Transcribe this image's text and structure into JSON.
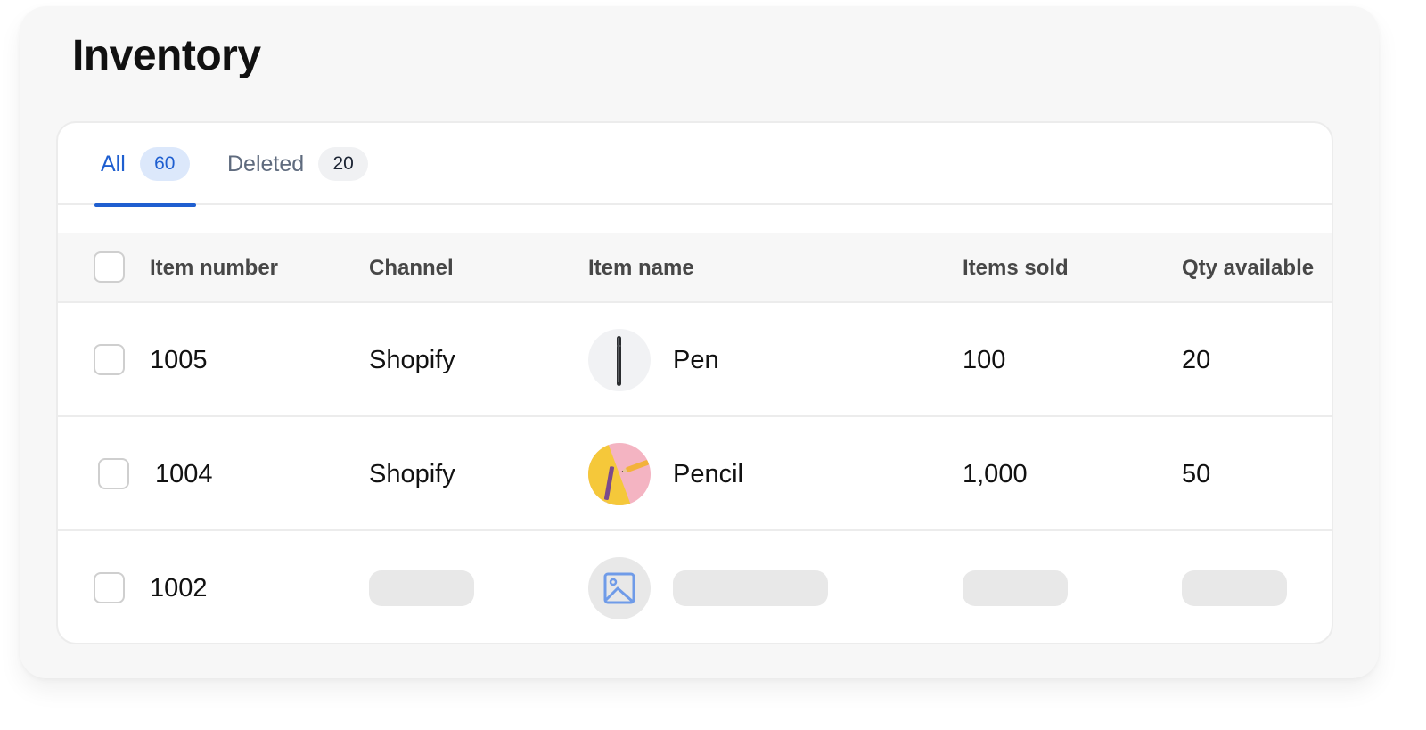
{
  "page": {
    "title": "Inventory"
  },
  "tabs": [
    {
      "label": "All",
      "count": "60",
      "active": true
    },
    {
      "label": "Deleted",
      "count": "20",
      "active": false
    }
  ],
  "table": {
    "columns": [
      "Item number",
      "Channel",
      "Item name",
      "Items sold",
      "Qty available"
    ],
    "rows": [
      {
        "item_number": "1005",
        "channel": "Shopify",
        "item_name": "Pen",
        "items_sold": "100",
        "qty_available": "20",
        "thumbnail": "pen-image"
      },
      {
        "item_number": "1004",
        "channel": "Shopify",
        "item_name": "Pencil",
        "items_sold": "1,000",
        "qty_available": "50",
        "thumbnail": "pencil-image"
      },
      {
        "item_number": "1002",
        "channel": "",
        "item_name": "",
        "items_sold": "",
        "qty_available": "",
        "thumbnail": "image-placeholder-icon",
        "loading": true
      }
    ]
  },
  "colors": {
    "accent": "#1f5fd0",
    "badge_active_bg": "#dce8fb",
    "skeleton": "#e8e8e8"
  }
}
